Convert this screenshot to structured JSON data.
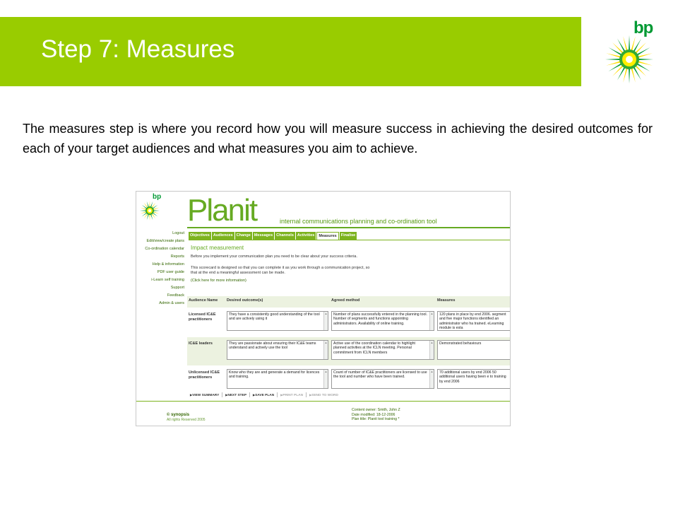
{
  "slide": {
    "title": "Step 7: Measures",
    "bp_logo_text": "bp",
    "intro": "The measures step is where you record how you will measure success in achieving the desired outcomes for each of your target audiences and what measures you aim to achieve.",
    "colors": {
      "title_bar": "#99cc00",
      "bp_green": "#009933",
      "bp_yellow": "#ffdd00"
    }
  },
  "app": {
    "logo_text": "bp",
    "product_name": "Planit",
    "tagline": "internal communications planning and co-ordination tool",
    "sidebar": [
      "Logout",
      "Edit/view/create plans",
      "Co-ordination calendar",
      "Reports",
      "Help & information",
      "PDF user guide",
      "i-Learn self training",
      "Support",
      "Feedback",
      "Admin & users"
    ],
    "tabs": [
      "Objectives",
      "Audiences",
      "Change",
      "Messages",
      "Channels",
      "Activities",
      "Measures",
      "Finalise"
    ],
    "active_tab": "Measures",
    "section_title": "Impact measurement",
    "para1": "Before you implement your communication plan you need to be clear about your success criteria.",
    "para2_line1": "This scorecard is designed so that you can complete it as you work through a communication project, so",
    "para2_line2": "that at the end a meaningful assessment can be made.",
    "help_link": "(Click here for more information)",
    "table": {
      "headers": [
        "Audience Name",
        "Desired outcome(s)",
        "Agreed method",
        "Measures"
      ],
      "rows": [
        {
          "audience": "Licensed IC&E practitioners",
          "outcome": "They have a consistently good understanding of the tool and are actively using it",
          "method": "Number of plans successfully entered in the planning tool. Number of segments and functions appointing administrators. Availability of online training.",
          "measure": "120 plans in place by end 2006. segment and five major functions identified an administrator who ha trained. eLearning module is esta"
        },
        {
          "audience": "IC&E leaders",
          "outcome": "They are passionate about ensuring their IC&E teams understand and actively use the tool",
          "method": "Active use of the coordination calendar to highlight planned activities at the ICLN meeting. Personal commitment from ICLN members",
          "measure": "Demonstrated behaviours"
        },
        {
          "audience": "Unlicensed IC&E practitioners",
          "outcome": "Know who they are and generate a demand for licences and training.",
          "method": "Count of number of IC&E practitioners are licensed to use the tool and number who have been trained.",
          "measure": "70 additional users by end 2006 50 additional users having been e to training by end 2006"
        }
      ]
    },
    "actions": [
      {
        "label": "VIEW SUMMARY",
        "enabled": true
      },
      {
        "label": "NEXT STEP",
        "enabled": true
      },
      {
        "label": "SAVE PLAN",
        "enabled": true
      },
      {
        "label": "PRINT PLAN",
        "enabled": false
      },
      {
        "label": "SEND TO WORD",
        "enabled": false
      }
    ],
    "copyright_brand": "© synopsis",
    "copyright_text": "All rights Reserved 2005",
    "content_owner": "Content owner: Smith, John Z",
    "date_modified": "Date modified: 18-12-2006",
    "plan_title": "Plan title: Planit tool training *",
    "colors": {
      "green": "#7db31f",
      "light_row": "#ecf2e0"
    }
  }
}
